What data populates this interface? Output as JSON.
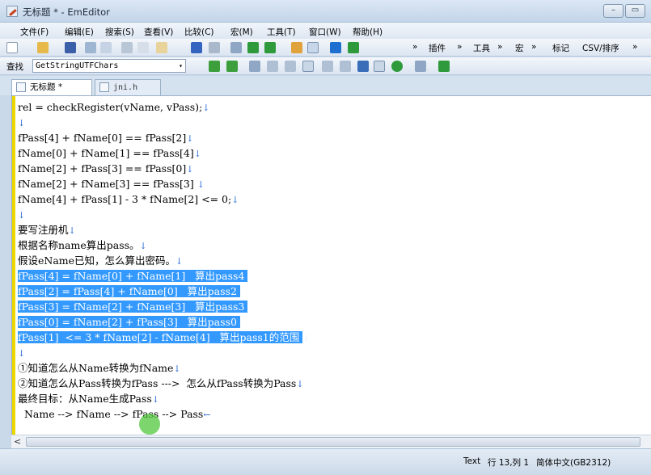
{
  "window": {
    "title": "无标题 * - EmEditor",
    "minimize": "–",
    "restore": "▭"
  },
  "menu": [
    "文件(F)",
    "编辑(E)",
    "搜索(S)",
    "查看(V)",
    "比较(C)",
    "宏(M)",
    "工具(T)",
    "窗口(W)",
    "帮助(H)"
  ],
  "toolbar": {
    "more1": "»",
    "plugins": "插件",
    "more2": "»",
    "tools": "工具",
    "more3": "»",
    "macros": "宏",
    "more4": "»",
    "marks": "标记",
    "csv": "CSV/排序",
    "more5": "»"
  },
  "find": {
    "label": "查找",
    "value": "GetStringUTFChars",
    "dropdown": "▾"
  },
  "tabs": [
    {
      "label": "无标题 *",
      "close": "×"
    },
    {
      "label": "jni.h"
    }
  ],
  "editor": {
    "lines": [
      {
        "text": "rel = checkRegister(vName, vPass);",
        "nl": "↓",
        "selected": false
      },
      {
        "text": "",
        "nl": "↓",
        "selected": false
      },
      {
        "text": "fPass[4] + fName[0] == fPass[2]",
        "nl": "↓",
        "selected": false
      },
      {
        "text": "fName[0] + fName[1] == fPass[4]",
        "nl": "↓",
        "selected": false
      },
      {
        "text": "fName[2] + fPass[3] == fPass[0]",
        "nl": "↓",
        "selected": false
      },
      {
        "text": "fName[2] + fName[3] == fPass[3] ",
        "nl": "↓",
        "selected": false
      },
      {
        "text": "fName[4] + fPass[1] - 3 * fName[2] <= 0;",
        "nl": "↓",
        "selected": false
      },
      {
        "text": "",
        "nl": "↓",
        "selected": false
      },
      {
        "text": "要写注册机",
        "nl": "↓",
        "selected": false
      },
      {
        "text": "根据名称name算出pass。",
        "nl": "↓",
        "selected": false
      },
      {
        "text": "假设eName已知，怎么算出密码。",
        "nl": "↓",
        "selected": false
      },
      {
        "text": "fPass[4] = fName[0] + fName[1]   算出pass4",
        "nl": "",
        "selected": true
      },
      {
        "text": "fPass[2] = fPass[4] + fName[0]   算出pass2",
        "nl": "",
        "selected": true
      },
      {
        "text": "fPass[3] = fName[2] + fName[3]   算出pass3",
        "nl": "",
        "selected": true
      },
      {
        "text": "fPass[0] = fName[2] + fPass[3]   算出pass0",
        "nl": "",
        "selected": true
      },
      {
        "text": "fPass[1]  <= 3 * fName[2] - fName[4]   算出pass1的范围",
        "nl": "↓",
        "selected": true
      },
      {
        "text": "",
        "nl": "↓",
        "selected": false
      },
      {
        "text": "①知道怎么从Name转换为fName",
        "nl": "↓",
        "selected": false
      },
      {
        "text": "②知道怎么从Pass转换为fPass --->  怎么从fPass转换为Pass",
        "nl": "↓",
        "selected": false
      },
      {
        "text": "最终目标：从Name生成Pass",
        "nl": "↓",
        "selected": false
      },
      {
        "text": "  Name --> fName --> fPass --> Pass",
        "nl": "←",
        "selected": false
      }
    ]
  },
  "scroll": {
    "left": "<"
  },
  "status": {
    "mode": "Text",
    "position": "行 13,列 1",
    "encoding": "简体中文(GB2312)"
  }
}
